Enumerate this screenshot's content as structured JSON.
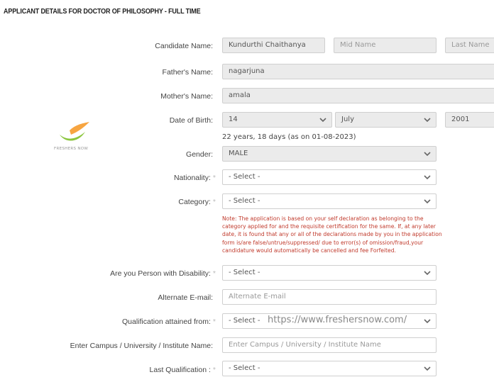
{
  "page": {
    "title": "APPLICANT DETAILS FOR DOCTOR OF PHILOSOPHY - FULL TIME"
  },
  "logo": {
    "text": "FRESHERS NOW"
  },
  "form": {
    "candidate_name": {
      "label": "Candidate Name:",
      "first": "Kundurthi Chaithanya",
      "mid_placeholder": "Mid Name",
      "last_placeholder": "Last Name"
    },
    "father_name": {
      "label": "Father's Name:",
      "value": "nagarjuna"
    },
    "mother_name": {
      "label": "Mother's Name:",
      "value": "amala"
    },
    "dob": {
      "label": "Date of Birth:",
      "day": "14",
      "month": "July",
      "year": "2001",
      "age_text": "22 years, 18 days (as on 01-08-2023)"
    },
    "gender": {
      "label": "Gender:",
      "value": "MALE"
    },
    "nationality": {
      "label": "Nationality:",
      "required": "*",
      "value": "- Select -"
    },
    "category": {
      "label": "Category:",
      "required": "*",
      "value": "- Select -",
      "note": "Note: The application is based on your self declaration as belonging to the category applied for and the requisite certification for the same. If, at any later date, it is found that any or all of the declarations made by you in the application form is/are false/untrue/suppressed/ due to error(s) of omission/fraud,your candidature would automatically be cancelled and fee Forfeited."
    },
    "disability": {
      "label": "Are you Person with Disability:",
      "required": "*",
      "value": "- Select -"
    },
    "alt_email": {
      "label": "Alternate E-mail:",
      "placeholder": "Alternate E-mail"
    },
    "qualification_from": {
      "label": "Qualification attained from:",
      "required": "*",
      "value": "- Select -"
    },
    "campus": {
      "label": "Enter Campus / University / Institute Name:",
      "placeholder": "Enter Campus / University / Institute Name"
    },
    "last_qualification": {
      "label": "Last Qualification :",
      "required": "*",
      "value": "- Select -"
    }
  },
  "watermark": "https://www.freshersnow.com/",
  "icons": {
    "dropdown": "chevron-down-icon",
    "logo": "freshersnow-logo"
  }
}
